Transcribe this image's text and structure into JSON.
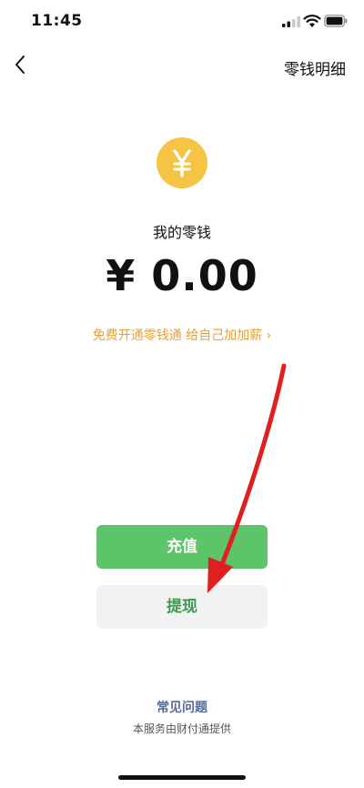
{
  "status_bar": {
    "time": "11:45"
  },
  "nav": {
    "title": "零钱明细"
  },
  "wallet": {
    "label": "我的零钱",
    "amount": "¥ 0.00",
    "coin_symbol": "¥",
    "promo": "免费开通零钱通 给自己加加薪 ›"
  },
  "actions": {
    "recharge": "充值",
    "withdraw": "提现"
  },
  "footer": {
    "faq": "常见问题",
    "note": "本服务由财付通提供"
  },
  "colors": {
    "coin": "#f6c443",
    "promo": "#e6a03b",
    "recharge_bg": "#5ec46a",
    "withdraw_text": "#3c9a50",
    "faq": "#576b95",
    "annotation_arrow": "#e02020"
  }
}
